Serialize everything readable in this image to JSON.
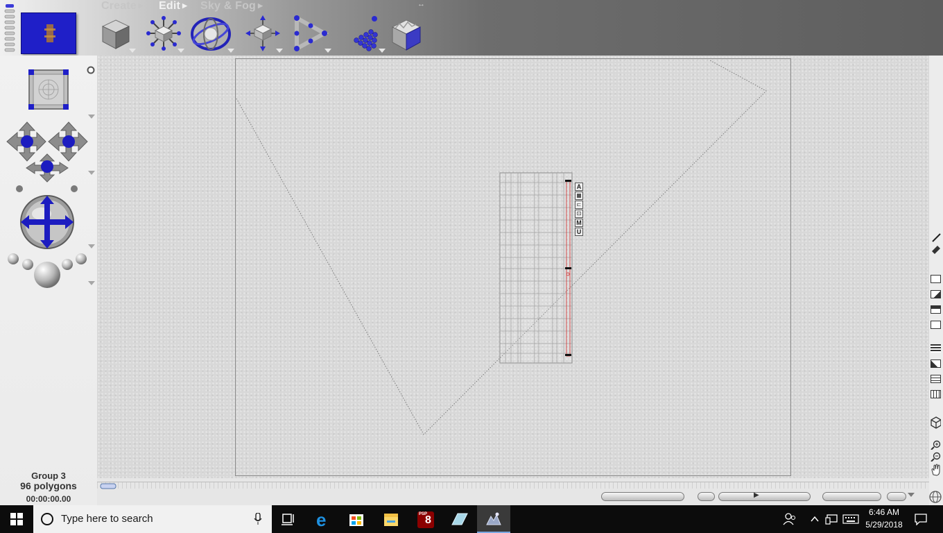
{
  "menu": {
    "create_label": "Create",
    "edit_label": "Edit",
    "skyfog_label": "Sky & Fog"
  },
  "status": {
    "object_name": "Group 3",
    "polygons": "96 polygons",
    "time": "00:00:00.00"
  },
  "palette_letters": [
    "A",
    "",
    "",
    "",
    "M",
    "U"
  ],
  "taskbar": {
    "search_placeholder": "Type here to search",
    "clock_time": "6:46 AM",
    "clock_date": "5/29/2018",
    "psp_badge": "PSP",
    "psp_version": "8"
  },
  "colors": {
    "accent_blue": "#1f1fc8",
    "viewport_bg": "#d8d8d8",
    "taskbar_bg": "#0c0c0c",
    "selection_red": "#d24a4a"
  }
}
